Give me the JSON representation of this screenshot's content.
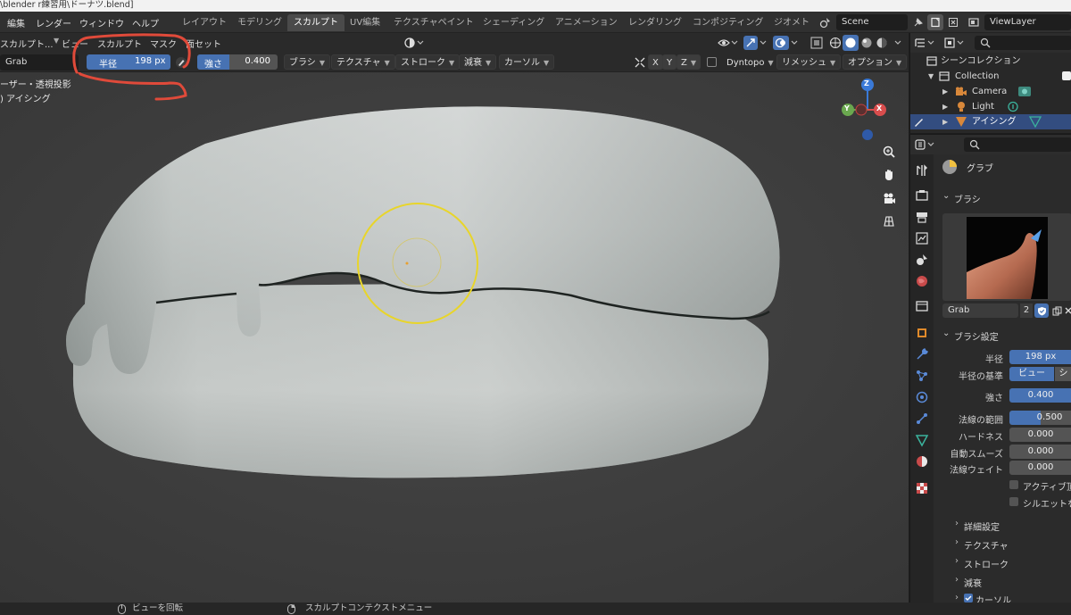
{
  "window": {
    "title": "\\blender r練習用\\ドーナツ.blend]"
  },
  "menu": {
    "items": [
      "編集",
      "レンダー",
      "ウィンドウ",
      "ヘルプ"
    ]
  },
  "workspaces": [
    "レイアウト",
    "モデリング",
    "スカルプト",
    "UV編集",
    "テクスチャペイント",
    "シェーディング",
    "アニメーション",
    "レンダリング",
    "コンポジティング",
    "ジオメト"
  ],
  "active_workspace": "スカルプト",
  "scene": {
    "name": "Scene",
    "view_layer": "ViewLayer"
  },
  "viewport_header": {
    "mode": "スカルプト...",
    "menus": [
      "ビュー",
      "スカルプト",
      "マスク",
      "面セット"
    ]
  },
  "tool_settings": {
    "brush_name": "Grab",
    "radius_label": "半径",
    "radius_value": "198 px",
    "strength_label": "強さ",
    "strength_value": "0.400",
    "strength_fraction": 0.4,
    "dropdowns": [
      "ブラシ",
      "テクスチャ",
      "ストローク",
      "減衰",
      "カーソル"
    ],
    "axes": [
      "X",
      "Y",
      "Z"
    ],
    "dyntopo": "Dyntopo",
    "remesh": "リメッシュ",
    "options": "オプション"
  },
  "overlay": {
    "line1": "ーザー・透視投影",
    "line2": ") アイシング"
  },
  "gizmo": {
    "z": "Z",
    "y": "Y",
    "x": "X"
  },
  "outliner": {
    "scene_collection": "シーンコレクション",
    "collection": "Collection",
    "items": [
      {
        "name": "Camera",
        "icon": "camera-icon"
      },
      {
        "name": "Light",
        "icon": "light-icon"
      },
      {
        "name": "アイシング",
        "icon": "mesh-icon"
      }
    ]
  },
  "properties": {
    "tool_name": "グラブ",
    "brush_section": "ブラシ",
    "brush_datablock": "Grab",
    "brush_users": "2",
    "brush_settings_section": "ブラシ設定",
    "radius_label": "半径",
    "radius_value": "198 px",
    "radius_basis_label": "半径の基準",
    "radius_basis_view": "ビュー",
    "radius_basis_scene": "シ",
    "strength_label": "強さ",
    "strength_value": "0.400",
    "normal_radius_label": "法線の範囲",
    "normal_radius_value": "0.500",
    "normal_radius_fraction": 0.5,
    "hardness_label": "ハードネス",
    "hardness_value": "0.000",
    "autosmooth_label": "自動スムーズ",
    "autosmooth_value": "0.000",
    "normal_weight_label": "法線ウェイト",
    "normal_weight_value": "0.000",
    "checkbox1": "アクティブ頂",
    "checkbox2": "シルエットを",
    "subpanels": [
      "詳細設定",
      "テクスチャ",
      "ストローク",
      "減衰",
      "カーソル"
    ]
  },
  "statusbar": {
    "item1": "ビューを回転",
    "item2": "スカルプトコンテクストメニュー"
  },
  "colors": {
    "accent_blue": "#4772b3",
    "annotation_red": "#e04a3a",
    "brush_circle": "#e8d52a"
  }
}
